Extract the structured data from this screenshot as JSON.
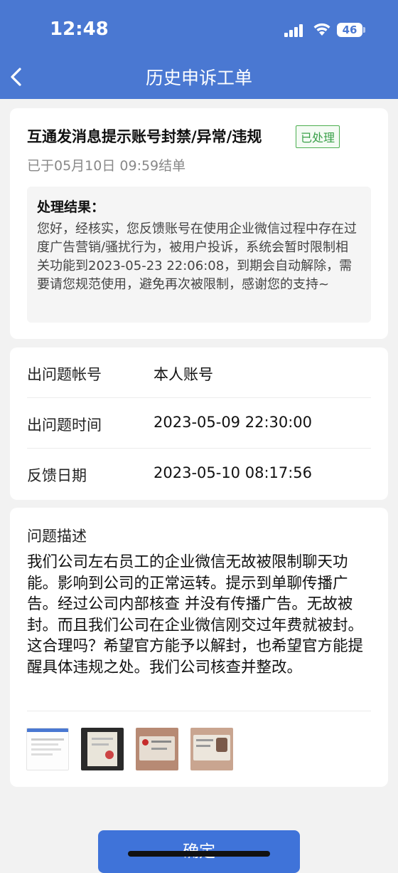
{
  "status_bar": {
    "time": "12:48",
    "battery": "46"
  },
  "nav": {
    "title": "历史申诉工单"
  },
  "ticket": {
    "title": "互通发消息提示账号封禁/异常/违规",
    "status": "已处理",
    "closed_time": "已于05月10日 09:59结单",
    "result_label": "处理结果：",
    "result_text": "您好，经核实，您反馈账号在使用企业微信过程中存在过度广告营销/骚扰行为，被用户投诉，系统会暂时限制相关功能到2023-05-23 22:06:08，到期会自动解除，需要请您规范使用，避免再次被限制，感谢您的支持~"
  },
  "info": {
    "rows": [
      {
        "label": "出问题帐号",
        "value": "本人账号"
      },
      {
        "label": "出问题时间",
        "value": "2023-05-09 22:30:00"
      },
      {
        "label": "反馈日期",
        "value": "2023-05-10 08:17:56"
      }
    ]
  },
  "description": {
    "label": "问题描述",
    "text": "我们公司左右员工的企业微信无故被限制聊天功能。影响到公司的正常运转。提示到单聊传播广告。经过公司内部核查 并没有传播广告。无故被封。而且我们公司在企业微信刚交过年费就被封。这合理吗？希望官方能予以解封，也希望官方能提醒具体违规之处。我们公司核查并整改。"
  },
  "footer": {
    "confirm_label": "确定"
  }
}
